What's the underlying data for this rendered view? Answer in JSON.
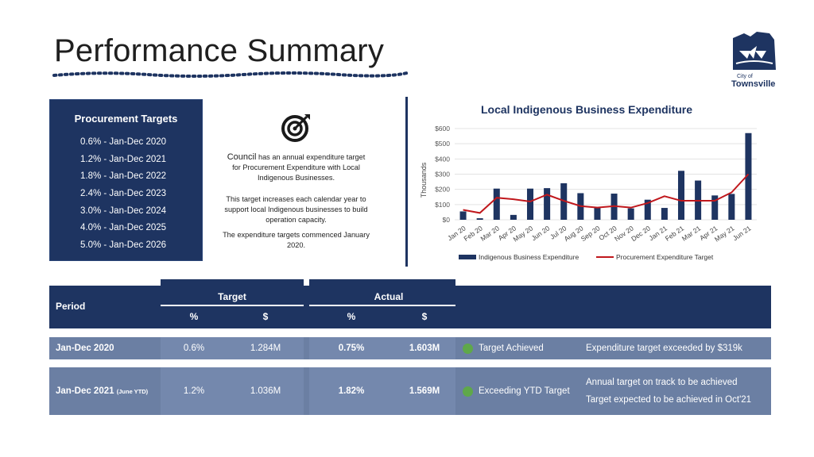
{
  "page": {
    "title": "Performance Summary"
  },
  "logo": {
    "city": "City of",
    "town": "Townsville"
  },
  "procurement_targets": {
    "heading": "Procurement Targets",
    "items": [
      "0.6% - Jan-Dec 2020",
      "1.2% - Jan-Dec 2021",
      "1.8% - Jan-Dec 2022",
      "2.4% - Jan-Dec 2023",
      "3.0% - Jan-Dec 2024",
      "4.0% - Jan-Dec 2025",
      "5.0% - Jan-Dec 2026"
    ]
  },
  "description": {
    "lead_word": "Council",
    "p1_rest": "has an annual expenditure target for Procurement Expenditure with Local Indigenous Businesses.",
    "p2": "This target increases each calendar year to support local Indigenous businesses to build operation capacity.",
    "p3": "The expenditure targets commenced January 2020."
  },
  "chart_data": {
    "type": "bar",
    "title": "Local Indigenous Business Expenditure",
    "ylabel": "Thousands",
    "ylim": [
      0,
      600
    ],
    "yticks": [
      "$0",
      "$100",
      "$200",
      "$300",
      "$400",
      "$500",
      "$600"
    ],
    "categories": [
      "Jan 20",
      "Feb 20",
      "Mar 20",
      "Apr 20",
      "May 20",
      "Jun 20",
      "Jul 20",
      "Aug 20",
      "Sep 20",
      "Oct 20",
      "Nov 20",
      "Dec 20",
      "Jan 21",
      "Feb 21",
      "Mar 21",
      "Apr 21",
      "May 21",
      "Jun 21"
    ],
    "series": [
      {
        "name": "Indigenous Business Expenditure",
        "kind": "bar",
        "color": "#1e3461",
        "values": [
          55,
          10,
          205,
          32,
          205,
          208,
          240,
          175,
          80,
          172,
          75,
          132,
          78,
          322,
          258,
          160,
          170,
          570
        ]
      },
      {
        "name": "Procurement Expenditure Target",
        "kind": "line",
        "color": "#c0171c",
        "values": [
          65,
          45,
          145,
          135,
          120,
          165,
          125,
          90,
          80,
          90,
          80,
          110,
          155,
          125,
          125,
          125,
          180,
          300
        ]
      }
    ],
    "legend": "bottom",
    "grid": true
  },
  "table": {
    "headers": {
      "period": "Period",
      "target": "Target",
      "actual": "Actual",
      "target_pct": "%",
      "target_dollar": "$",
      "actual_pct": "%",
      "actual_dollar": "$"
    },
    "rows": [
      {
        "period": "Jan-Dec 2020",
        "period_suffix": "",
        "target_pct": "0.6%",
        "target_dollar": "1.284M",
        "actual_pct": "0.75%",
        "actual_dollar": "1.603M",
        "status": "Target Achieved",
        "status_color": "#5fa84a",
        "comment1": "Expenditure target exceeded by $319k",
        "comment2": ""
      },
      {
        "period": "Jan-Dec 2021",
        "period_suffix": "(June YTD)",
        "target_pct": "1.2%",
        "target_dollar": "1.036M",
        "actual_pct": "1.82%",
        "actual_dollar": "1.569M",
        "status": "Exceeding YTD Target",
        "status_color": "#5fa84a",
        "comment1": "Annual target on track to be achieved",
        "comment2": "Target expected to be achieved in Oct'21"
      }
    ]
  }
}
